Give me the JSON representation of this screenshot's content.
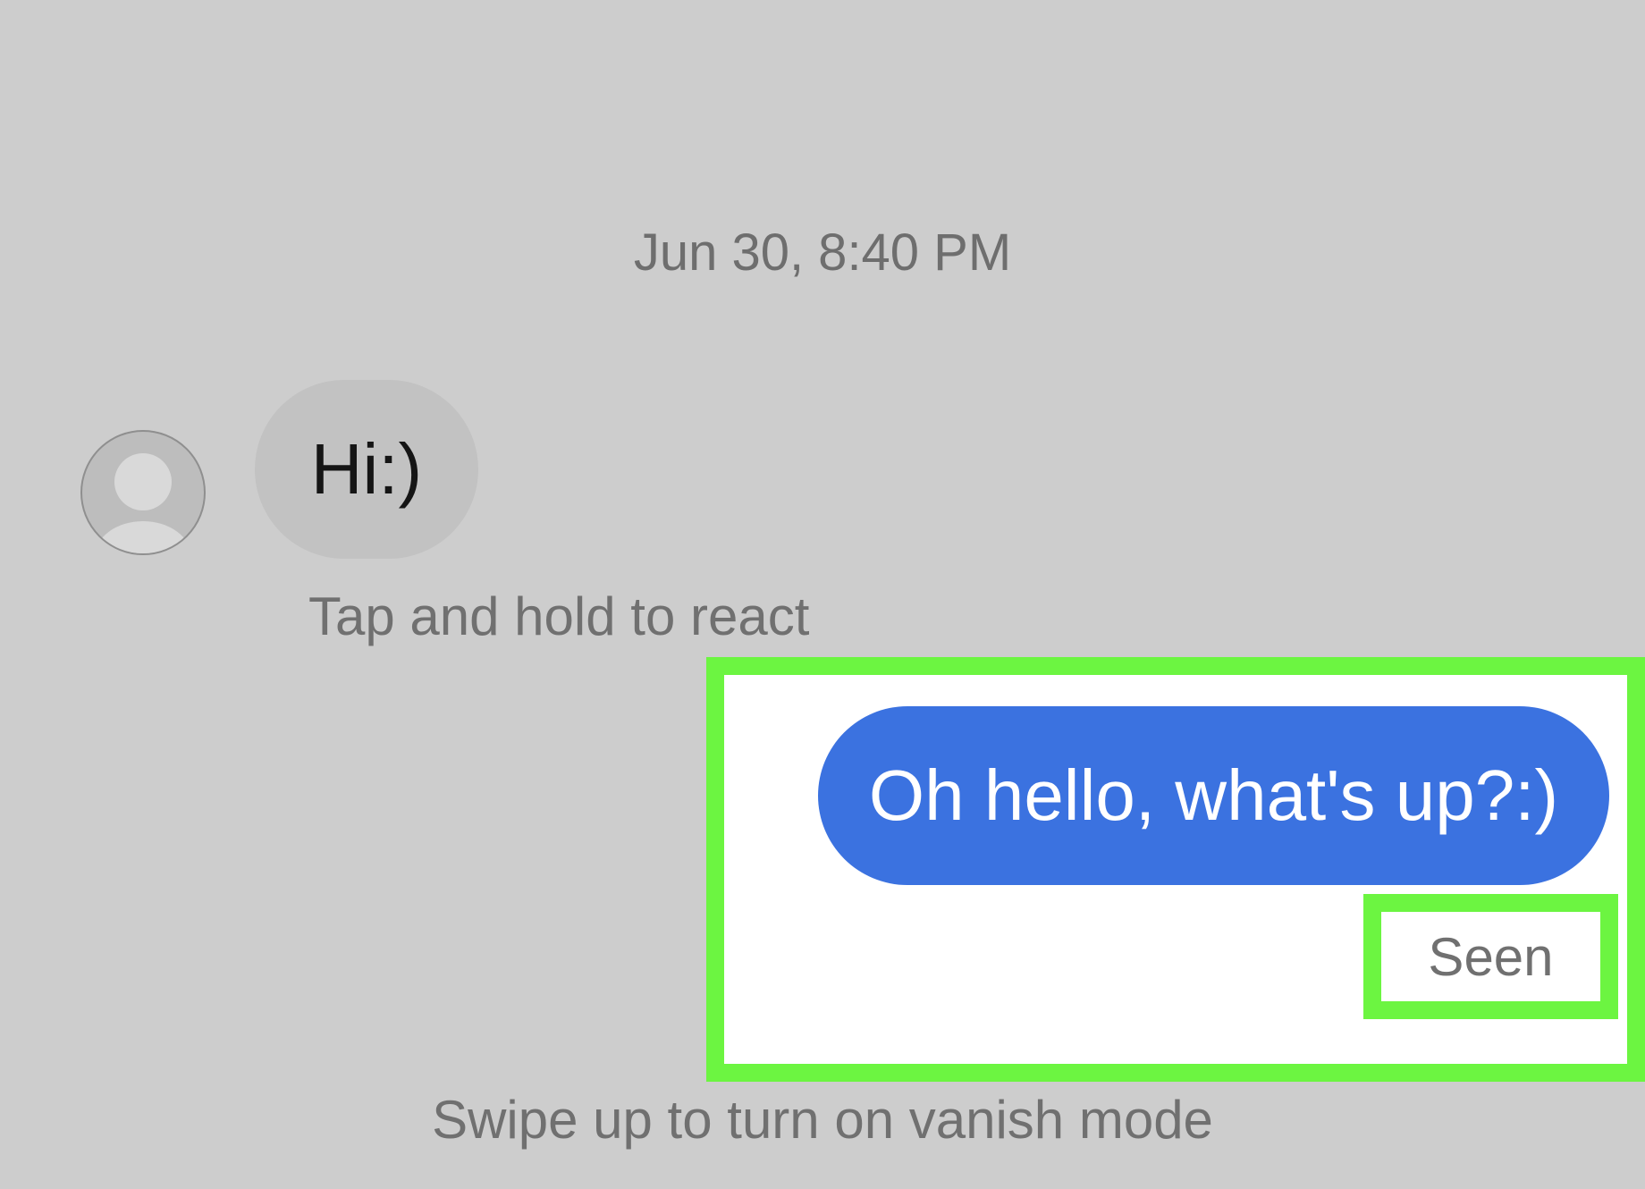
{
  "conversation": {
    "timestamp": "Jun 30, 8:40 PM",
    "incoming_message": "Hi:)",
    "react_hint": "Tap and hold to react",
    "outgoing_message": "Oh hello, what's up?:)",
    "read_status": "Seen",
    "vanish_hint": "Swipe up to turn on vanish mode"
  },
  "colors": {
    "background": "#cdcdcd",
    "incoming_bubble": "#c2c2c2",
    "outgoing_bubble": "#3b72e0",
    "highlight": "#6cf541"
  },
  "icons": {
    "avatar": "default-user-avatar-icon"
  }
}
